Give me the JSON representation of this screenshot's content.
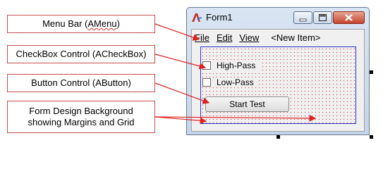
{
  "callouts": {
    "menu_bar": {
      "prefix": "Menu Bar (",
      "class_name": "AMenu",
      "suffix": ")"
    },
    "checkbox": {
      "text": "CheckBox Control (ACheckBox)"
    },
    "button": {
      "text": "Button Control (AButton)"
    },
    "design_background": {
      "line1": "Form Design Background",
      "line2": "showing Margins and Grid"
    }
  },
  "window": {
    "title": "Form1",
    "app_icon": "app-logo-icon",
    "caption_buttons": [
      "minimize-icon",
      "maximize-icon",
      "close-icon"
    ]
  },
  "menu": {
    "items": [
      "File",
      "Edit",
      "View",
      "<New Item>"
    ]
  },
  "form": {
    "checkboxes": [
      {
        "label": "High-Pass",
        "checked": false
      },
      {
        "label": "Low-Pass",
        "checked": false
      }
    ],
    "start_button": "Start Test"
  },
  "colors": {
    "callout_border": "#c0504d",
    "arrow": "#e02020",
    "grid_dot": "#d23a3a",
    "design_border": "#2b35c8"
  }
}
